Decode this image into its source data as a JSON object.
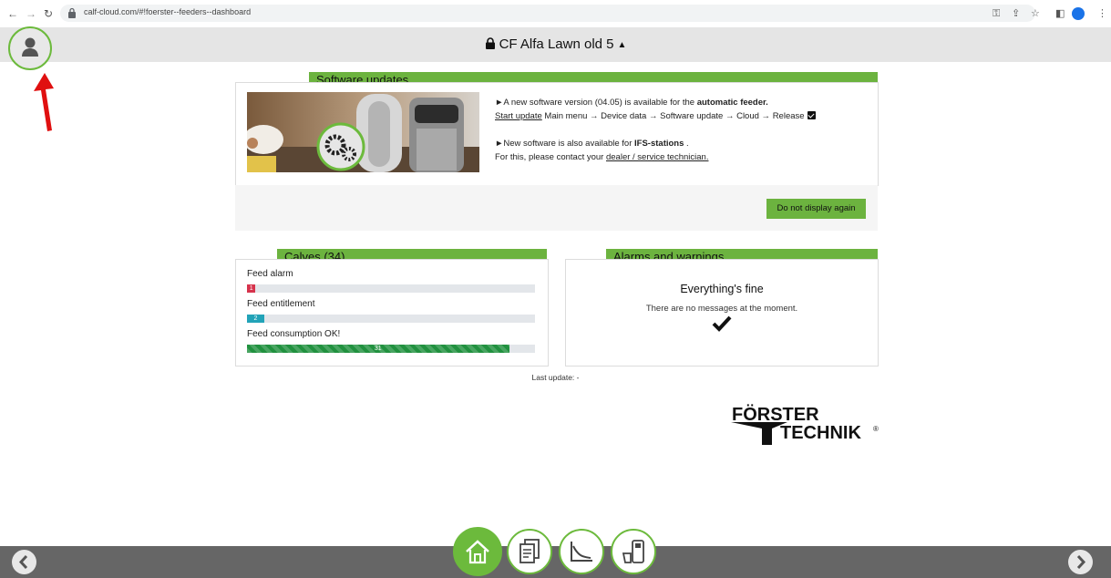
{
  "browser": {
    "url": "calf-cloud.com/#!foerster--feeders--dashboard"
  },
  "header": {
    "title": "CF Alfa Lawn old 5",
    "caret": "▲"
  },
  "software_updates": {
    "title": "Software updates",
    "line1_prefix": "►A new software version (04.05) is available for the ",
    "line1_bold": "automatic feeder.",
    "line2_link": "Start update",
    "line2_rest": " Main menu → Device data → Software update → Cloud → Release",
    "line3_prefix": "►New software is also available for ",
    "line3_bold": "IFS-stations",
    "line3_suffix": " .",
    "line4_prefix": "For this, please contact your ",
    "line4_link": "dealer / service technician.",
    "dismiss_button": "Do not display again"
  },
  "calves": {
    "title": "Calves (34)",
    "rows": [
      {
        "label": "Feed alarm",
        "count": "1",
        "fraction": 0.03
      },
      {
        "label": "Feed entitlement",
        "count": "2",
        "fraction": 0.06
      },
      {
        "label": "Feed consumption OK!",
        "count": "31",
        "fraction": 0.91
      }
    ]
  },
  "alarms": {
    "title": "Alarms and warnings",
    "heading": "Everything's fine",
    "message": "There are no messages at the moment."
  },
  "last_update": "Last update: -",
  "brand": {
    "line1": "FÖRSTER",
    "line2": "TECHNIK",
    "reg": "®"
  },
  "colors": {
    "accent_green": "#6cb33f",
    "alarm_red": "#d6334c",
    "teal": "#22a3b8",
    "ok_green": "#21913f"
  }
}
